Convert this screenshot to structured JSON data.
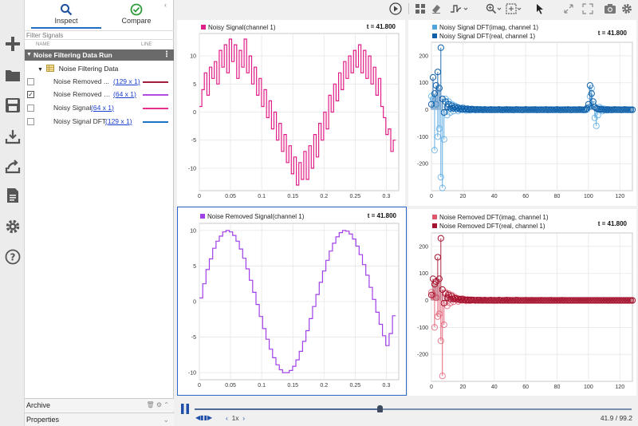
{
  "tabs": [
    {
      "label": "Inspect",
      "active": true
    },
    {
      "label": "Compare",
      "active": false
    }
  ],
  "filter_placeholder": "Filter Signals",
  "columns": {
    "name": "NAME",
    "line": "LINE"
  },
  "run": {
    "label": "Noise Filtering Data Run"
  },
  "group": {
    "label": "Noise Filtering Data"
  },
  "signals": [
    {
      "name": "Noise Removed ...",
      "size": "129 x 1",
      "color": "#a31d3c",
      "checked": false
    },
    {
      "name": "Noise Removed Si...",
      "size": "64 x 1",
      "color": "#b44be1",
      "checked": true
    },
    {
      "name": "Noisy Signal",
      "size": "64 x 1",
      "color": "#e8308f",
      "checked": false
    },
    {
      "name": "Noisy Signal DFT",
      "size": "129 x 1",
      "color": "#1f73c4",
      "checked": false
    }
  ],
  "archive_label": "Archive",
  "properties_label": "Properties",
  "plots": {
    "noisy": {
      "legend": "Noisy Signal(channel 1)",
      "t": "t = 41.800",
      "color": "#e01e87"
    },
    "noisy_dft": {
      "legend_imag": "Noisy Signal DFT(imag, channel 1)",
      "legend_real": "Noisy Signal DFT(real, channel 1)",
      "t": "t = 41.800",
      "color_imag": "#4fa4e0",
      "color_real": "#0f5fa8"
    },
    "removed": {
      "legend": "Noise Removed Signal(channel 1)",
      "t": "t = 41.800",
      "color": "#a040e8"
    },
    "removed_dft": {
      "legend_imag": "Noise Removed DFT(imag, channel 1)",
      "legend_real": "Noise Removed DFT(real, channel 1)",
      "t": "t = 41.800",
      "color_imag": "#e0566e",
      "color_real": "#a3122e"
    }
  },
  "chart_data": [
    {
      "type": "line",
      "series": [
        {
          "name": "Noisy Signal(channel 1)",
          "values": [
            1,
            4,
            7,
            3,
            8,
            6,
            9,
            5,
            11,
            8,
            12,
            7,
            13,
            9,
            12,
            6,
            11,
            8,
            13,
            7,
            10,
            5,
            8,
            3,
            6,
            1,
            4,
            -1,
            2,
            -3,
            0,
            -5,
            -2,
            -7,
            -4,
            -9,
            -6,
            -11,
            -8,
            -13,
            -9,
            -12,
            -7,
            -12,
            -6,
            -10,
            -4,
            -8,
            -2,
            -5,
            0,
            -3,
            3,
            0,
            5,
            2,
            7,
            4,
            9,
            6,
            10,
            7,
            11,
            8,
            12,
            7,
            11,
            6,
            10,
            5,
            8,
            3,
            6,
            1,
            -1,
            -4,
            -3,
            -7,
            -5
          ]
        }
      ],
      "xlim": [
        0,
        0.32
      ],
      "ylim": [
        -14,
        14
      ],
      "xticks": [
        0,
        0.05,
        0.1,
        0.15,
        0.2,
        0.25,
        0.3
      ],
      "yticks": [
        -10,
        -5,
        0,
        5,
        10
      ],
      "grid": true
    },
    {
      "type": "scatter",
      "series": [
        {
          "name": "Noisy Signal DFT(imag, channel 1)",
          "values": [
            50,
            40,
            -150,
            20,
            -100,
            -70,
            -250,
            -290,
            -110,
            40,
            -20,
            30,
            -10,
            20,
            -5,
            15,
            10,
            -5,
            5,
            0,
            8,
            3,
            -3,
            4,
            2,
            -2,
            3,
            1,
            -1,
            2,
            1,
            0,
            1,
            -1,
            1,
            0,
            0,
            1,
            -1,
            0,
            1,
            0,
            0,
            1,
            0,
            -1,
            0,
            1,
            0,
            0,
            1,
            0,
            -1,
            0,
            0,
            1,
            0,
            0,
            -1,
            0,
            1,
            0,
            0,
            0,
            1,
            0,
            0,
            -1,
            0,
            0,
            1,
            0,
            0,
            0,
            -1,
            0,
            1,
            0,
            0,
            0,
            1,
            0,
            -1,
            0,
            0,
            1,
            0,
            0,
            0,
            -1,
            0,
            1,
            0,
            0,
            0,
            1,
            0,
            -1,
            0,
            0,
            10,
            50,
            80,
            20,
            -30,
            -60,
            -20,
            10,
            5,
            -5,
            3,
            0,
            -2,
            1,
            0,
            -1,
            1,
            0,
            0,
            1,
            0,
            -1,
            0,
            0,
            1,
            0,
            0,
            0,
            0
          ]
        },
        {
          "name": "Noisy Signal DFT(real, channel 1)",
          "values": [
            20,
            120,
            60,
            90,
            140,
            80,
            230,
            40,
            -10,
            30,
            10,
            20,
            5,
            15,
            5,
            10,
            3,
            8,
            2,
            5,
            1,
            4,
            1,
            3,
            0,
            2,
            1,
            1,
            0,
            1,
            0,
            1,
            0,
            0,
            1,
            0,
            0,
            0,
            1,
            0,
            0,
            0,
            0,
            1,
            0,
            0,
            0,
            0,
            1,
            0,
            0,
            0,
            0,
            0,
            1,
            0,
            0,
            0,
            0,
            0,
            1,
            0,
            0,
            0,
            0,
            0,
            1,
            0,
            0,
            0,
            0,
            0,
            0,
            1,
            0,
            0,
            0,
            0,
            0,
            0,
            1,
            0,
            0,
            0,
            0,
            0,
            0,
            1,
            0,
            0,
            0,
            0,
            0,
            0,
            1,
            0,
            0,
            0,
            0,
            5,
            20,
            90,
            60,
            30,
            10,
            5,
            3,
            2,
            1,
            1,
            0,
            0,
            1,
            0,
            0,
            0,
            0,
            1,
            0,
            0,
            0,
            0,
            0,
            1,
            0,
            0,
            0,
            0,
            0
          ]
        }
      ],
      "xlim": [
        0,
        128
      ],
      "ylim": [
        -300,
        250
      ],
      "xticks": [
        0,
        20,
        40,
        60,
        80,
        100,
        120
      ],
      "yticks": [
        -200,
        -100,
        0,
        100,
        200
      ],
      "grid": true
    },
    {
      "type": "line",
      "series": [
        {
          "name": "Noise Removed Signal(channel 1)",
          "values": [
            0.5,
            2.5,
            4.5,
            6,
            7.5,
            8.5,
            9.2,
            9.8,
            10,
            9.8,
            9.3,
            8.5,
            7.4,
            6.1,
            4.6,
            3,
            1.3,
            -0.4,
            -2.1,
            -3.8,
            -5.3,
            -6.7,
            -7.9,
            -8.9,
            -9.6,
            -10,
            -10,
            -9.7,
            -9.1,
            -8.2,
            -7,
            -5.6,
            -4.1,
            -2.4,
            -0.7,
            1,
            2.7,
            4.3,
            5.8,
            7.1,
            8.2,
            9.1,
            9.7,
            10,
            9.9,
            9.5,
            8.8,
            7.8,
            6.6,
            5.2,
            3.7,
            2,
            0.3,
            -1.5,
            -3.2,
            -4.8,
            -6.2,
            -4.5,
            -2
          ]
        }
      ],
      "xlim": [
        0,
        0.32
      ],
      "ylim": [
        -11,
        11
      ],
      "xticks": [
        0,
        0.05,
        0.1,
        0.15,
        0.2,
        0.25,
        0.3
      ],
      "yticks": [
        -10,
        -5,
        0,
        5,
        10
      ],
      "grid": true
    },
    {
      "type": "scatter",
      "series": [
        {
          "name": "Noise Removed DFT(imag, channel 1)",
          "values": [
            30,
            20,
            -100,
            10,
            -60,
            -50,
            -150,
            -280,
            -90,
            30,
            -20,
            25,
            -10,
            20,
            -5,
            12,
            8,
            -4,
            5,
            0,
            6,
            3,
            -2,
            3,
            2,
            -1,
            2,
            1,
            0,
            1,
            1,
            0,
            1,
            0,
            1,
            0,
            0,
            1,
            0,
            0,
            1,
            0,
            0,
            1,
            0,
            0,
            0,
            1,
            0,
            0,
            1,
            0,
            0,
            0,
            0,
            1,
            0,
            0,
            0,
            0,
            1,
            0,
            0,
            0,
            1,
            0,
            0,
            0,
            0,
            0,
            1,
            0,
            0,
            0,
            0,
            0,
            1,
            0,
            0,
            0,
            0,
            0,
            0,
            1,
            0,
            0,
            0,
            0,
            0,
            0,
            0,
            0,
            0,
            0,
            0,
            0,
            0,
            0,
            0,
            0,
            0,
            0,
            0,
            0,
            0,
            0,
            0,
            0,
            0,
            0,
            0,
            0,
            0,
            0,
            0,
            0,
            0,
            0,
            0,
            0,
            0,
            0,
            0,
            0,
            0,
            0,
            0,
            0,
            0
          ]
        },
        {
          "name": "Noise Removed DFT(real, channel 1)",
          "values": [
            20,
            80,
            60,
            70,
            160,
            80,
            230,
            40,
            -10,
            25,
            10,
            20,
            5,
            15,
            5,
            8,
            3,
            6,
            2,
            5,
            1,
            3,
            1,
            2,
            0,
            2,
            1,
            1,
            0,
            1,
            0,
            1,
            0,
            0,
            1,
            0,
            0,
            0,
            1,
            0,
            0,
            0,
            0,
            1,
            0,
            0,
            0,
            0,
            1,
            0,
            0,
            0,
            0,
            0,
            1,
            0,
            0,
            0,
            0,
            0,
            0,
            0,
            0,
            0,
            0,
            0,
            0,
            0,
            0,
            0,
            0,
            0,
            0,
            0,
            0,
            0,
            0,
            0,
            0,
            0,
            0,
            0,
            0,
            0,
            0,
            0,
            0,
            0,
            0,
            0,
            0,
            0,
            0,
            0,
            0,
            0,
            0,
            0,
            0,
            0,
            0,
            0,
            0,
            0,
            0,
            0,
            0,
            0,
            0,
            0,
            0,
            0,
            0,
            0,
            0,
            0,
            0,
            0,
            0,
            0,
            0,
            0,
            0,
            0,
            0,
            0,
            0,
            0,
            0
          ]
        }
      ],
      "xlim": [
        0,
        128
      ],
      "ylim": [
        -300,
        250
      ],
      "xticks": [
        0,
        20,
        40,
        60,
        80,
        100,
        120
      ],
      "yticks": [
        -200,
        -100,
        0,
        100,
        200
      ],
      "grid": true
    }
  ],
  "playback": {
    "speed": "1x",
    "time": "41.9 / 99.2",
    "progress": 0.4225
  }
}
